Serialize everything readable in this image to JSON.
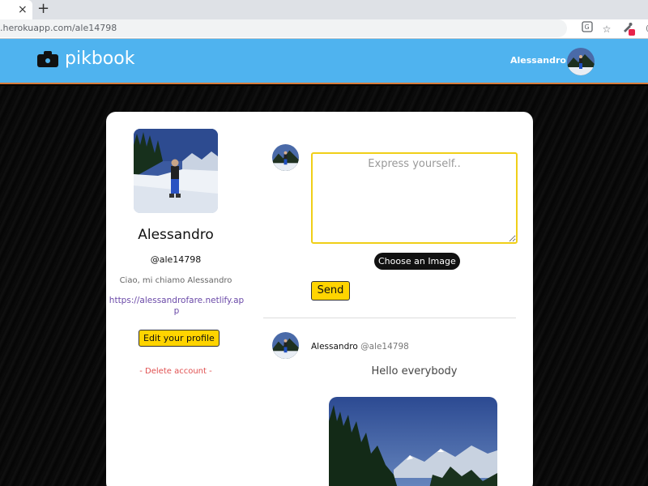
{
  "browser": {
    "tab_close": "×",
    "new_tab": "+",
    "url": ".herokuapp.com/ale14798",
    "icons": [
      "translate-icon",
      "star-icon",
      "extension-icon"
    ]
  },
  "header": {
    "logo_text": "pikbook",
    "user_name": "Alessandro"
  },
  "profile": {
    "name": "Alessandro",
    "handle": "@ale14798",
    "bio": "Ciao, mi chiamo Alessandro",
    "website": "https://alessandrofare.netlify.app",
    "edit_label": "Edit your profile",
    "delete_label": "- Delete account -"
  },
  "composer": {
    "placeholder": "Express yourself..",
    "choose_image_label": "Choose an Image",
    "send_label": "Send"
  },
  "post": {
    "author": "Alessandro",
    "handle": "@ale14798",
    "text": "Hello everybody"
  },
  "colors": {
    "header_bg": "#4fb3ef",
    "accent_yellow": "#ffd400",
    "link_purple": "#6b4aa8",
    "delete_red": "#e05050"
  }
}
